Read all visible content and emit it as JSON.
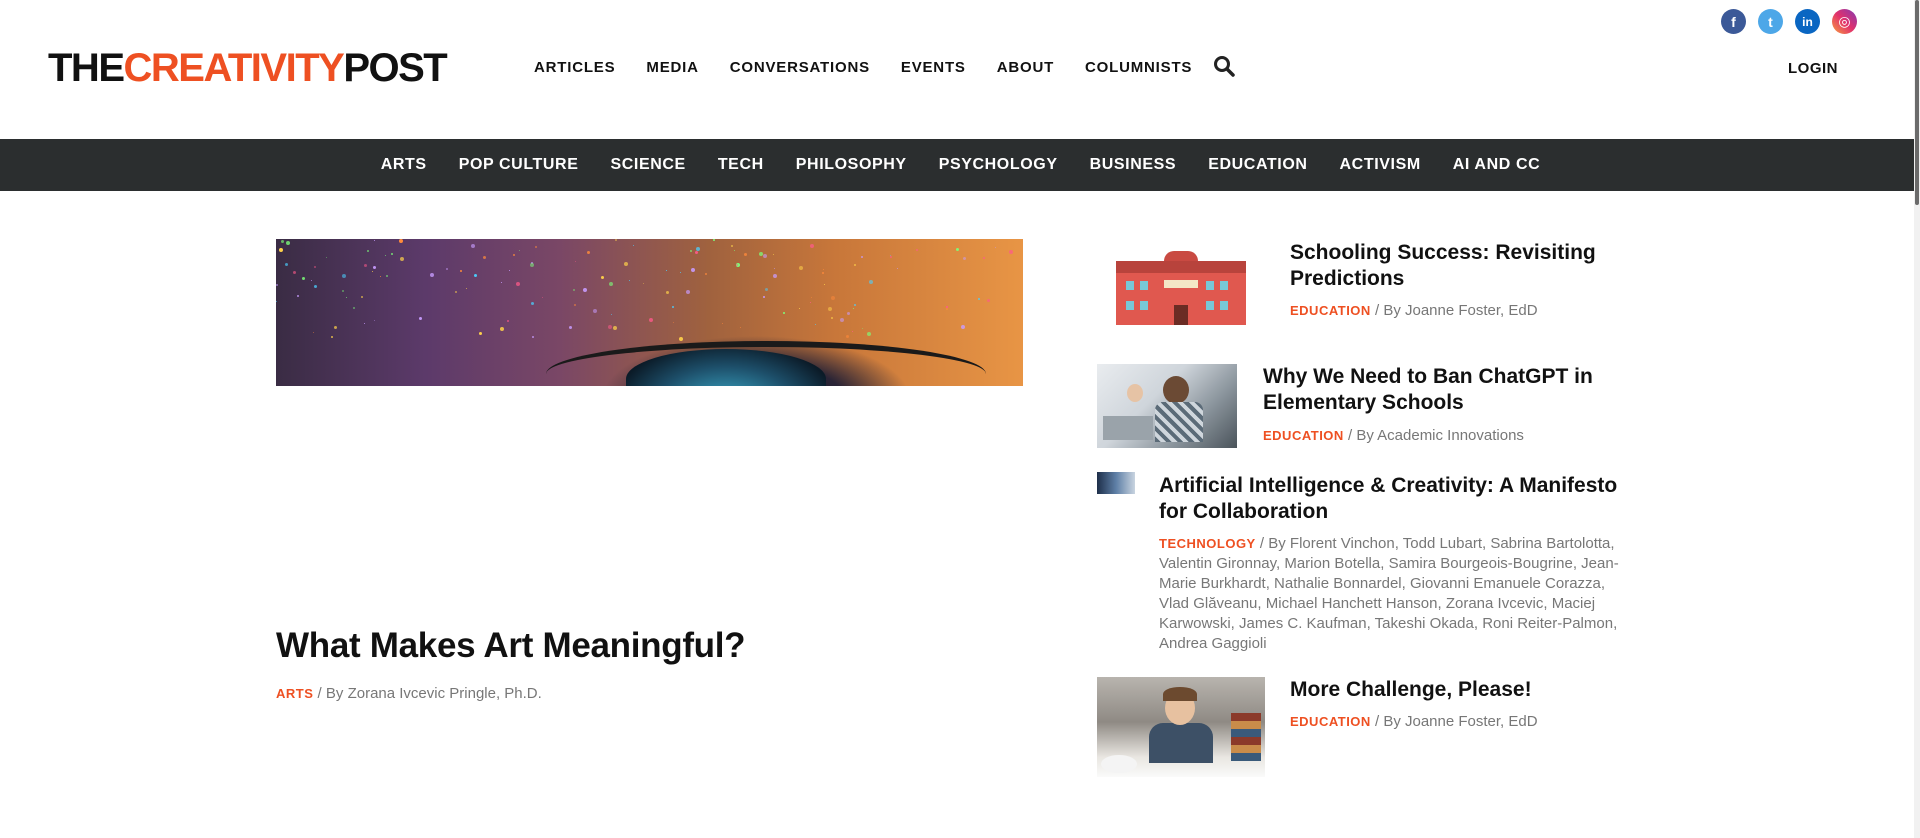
{
  "social": {
    "icons": [
      "facebook-icon",
      "twitter-icon",
      "linkedin-icon",
      "instagram-icon"
    ],
    "facebook_glyph": "f",
    "twitter_glyph": "t",
    "linkedin_glyph": "in",
    "instagram_glyph": "◎"
  },
  "header": {
    "logo": {
      "part1": "THE",
      "part2": "CREATIVITY",
      "part3": "POST"
    },
    "nav": [
      "ARTICLES",
      "MEDIA",
      "CONVERSATIONS",
      "EVENTS",
      "ABOUT",
      "COLUMNISTS"
    ],
    "search_icon": "search-icon",
    "login": "LOGIN"
  },
  "categories": [
    "ARTS",
    "POP CULTURE",
    "SCIENCE",
    "TECH",
    "PHILOSOPHY",
    "PSYCHOLOGY",
    "BUSINESS",
    "EDUCATION",
    "ACTIVISM",
    "AI AND CC"
  ],
  "featured": {
    "title": "What Makes Art Meaningful?",
    "category": "ARTS",
    "byline": " / By Zorana Ivcevic Pringle, Ph.D."
  },
  "side_articles": [
    {
      "title": "Schooling Success: Revisiting Predictions",
      "category": "EDUCATION",
      "byline": " / By Joanne Foster, EdD"
    },
    {
      "title": "Why We Need to Ban ChatGPT in Elementary Schools",
      "category": "EDUCATION",
      "byline": " / By Academic Innovations"
    },
    {
      "title": "Artificial Intelligence & Creativity: A Manifesto for Collaboration",
      "category": "TECHNOLOGY",
      "byline": " / By Florent Vinchon, Todd Lubart, Sabrina Bartolotta, Valentin Gironnay, Marion Botella, Samira Bourgeois-Bougrine, Jean-Marie Burkhardt, Nathalie Bonnardel, Giovanni Emanuele Corazza, Vlad Glăveanu, Michael Hanchett Hanson, Zorana Ivcevic, Maciej Karwowski, James C. Kaufman, Takeshi Okada, Roni Reiter-Palmon, Andrea Gaggioli"
    },
    {
      "title": "More Challenge, Please!",
      "category": "EDUCATION",
      "byline": " / By Joanne Foster, EdD"
    }
  ],
  "colors": {
    "accent": "#ee5022",
    "category_bar": "#2b2e2f"
  }
}
